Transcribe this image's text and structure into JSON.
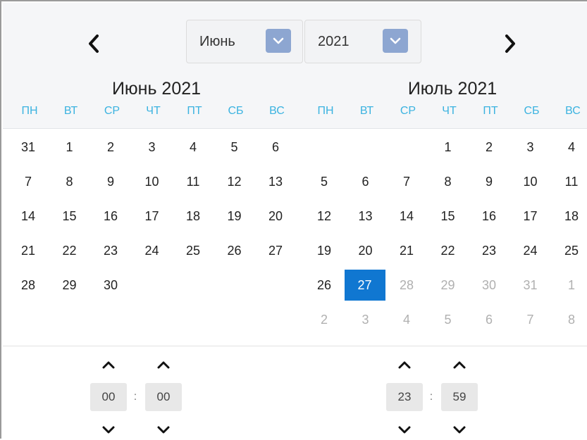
{
  "header": {
    "month_select": {
      "value": "Июнь"
    },
    "year_select": {
      "value": "2021"
    }
  },
  "calendars": [
    {
      "title": "Июнь 2021",
      "weekdays": [
        "ПН",
        "ВТ",
        "СР",
        "ЧТ",
        "ПТ",
        "СБ",
        "ВС"
      ],
      "weeks": [
        [
          {
            "d": "31",
            "m": false
          },
          {
            "d": "1",
            "m": false
          },
          {
            "d": "2",
            "m": false
          },
          {
            "d": "3",
            "m": false
          },
          {
            "d": "4",
            "m": false
          },
          {
            "d": "5",
            "m": false
          },
          {
            "d": "6",
            "m": false
          }
        ],
        [
          {
            "d": "7",
            "m": false
          },
          {
            "d": "8",
            "m": false
          },
          {
            "d": "9",
            "m": false
          },
          {
            "d": "10",
            "m": false
          },
          {
            "d": "11",
            "m": false
          },
          {
            "d": "12",
            "m": false
          },
          {
            "d": "13",
            "m": false
          }
        ],
        [
          {
            "d": "14",
            "m": false
          },
          {
            "d": "15",
            "m": false
          },
          {
            "d": "16",
            "m": false
          },
          {
            "d": "17",
            "m": false
          },
          {
            "d": "18",
            "m": false
          },
          {
            "d": "19",
            "m": false
          },
          {
            "d": "20",
            "m": false
          }
        ],
        [
          {
            "d": "21",
            "m": false
          },
          {
            "d": "22",
            "m": false
          },
          {
            "d": "23",
            "m": false
          },
          {
            "d": "24",
            "m": false
          },
          {
            "d": "25",
            "m": false
          },
          {
            "d": "26",
            "m": false
          },
          {
            "d": "27",
            "m": false
          }
        ],
        [
          {
            "d": "28",
            "m": false
          },
          {
            "d": "29",
            "m": false
          },
          {
            "d": "30",
            "m": false
          },
          null,
          null,
          null,
          null
        ],
        [
          null,
          null,
          null,
          null,
          null,
          null,
          null
        ]
      ]
    },
    {
      "title": "Июль 2021",
      "weekdays": [
        "ПН",
        "ВТ",
        "СР",
        "ЧТ",
        "ПТ",
        "СБ",
        "ВС"
      ],
      "weeks": [
        [
          null,
          null,
          null,
          {
            "d": "1",
            "m": false
          },
          {
            "d": "2",
            "m": false
          },
          {
            "d": "3",
            "m": false
          },
          {
            "d": "4",
            "m": false
          }
        ],
        [
          {
            "d": "5",
            "m": false
          },
          {
            "d": "6",
            "m": false
          },
          {
            "d": "7",
            "m": false
          },
          {
            "d": "8",
            "m": false
          },
          {
            "d": "9",
            "m": false
          },
          {
            "d": "10",
            "m": false
          },
          {
            "d": "11",
            "m": false
          }
        ],
        [
          {
            "d": "12",
            "m": false
          },
          {
            "d": "13",
            "m": false
          },
          {
            "d": "14",
            "m": false
          },
          {
            "d": "15",
            "m": false
          },
          {
            "d": "16",
            "m": false
          },
          {
            "d": "17",
            "m": false
          },
          {
            "d": "18",
            "m": false
          }
        ],
        [
          {
            "d": "19",
            "m": false
          },
          {
            "d": "20",
            "m": false
          },
          {
            "d": "21",
            "m": false
          },
          {
            "d": "22",
            "m": false
          },
          {
            "d": "23",
            "m": false
          },
          {
            "d": "24",
            "m": false
          },
          {
            "d": "25",
            "m": false
          }
        ],
        [
          {
            "d": "26",
            "m": false
          },
          {
            "d": "27",
            "m": false,
            "sel": true
          },
          {
            "d": "28",
            "m": true
          },
          {
            "d": "29",
            "m": true
          },
          {
            "d": "30",
            "m": true
          },
          {
            "d": "31",
            "m": true
          },
          {
            "d": "1",
            "m": true
          }
        ],
        [
          {
            "d": "2",
            "m": true
          },
          {
            "d": "3",
            "m": true
          },
          {
            "d": "4",
            "m": true
          },
          {
            "d": "5",
            "m": true
          },
          {
            "d": "6",
            "m": true
          },
          {
            "d": "7",
            "m": true
          },
          {
            "d": "8",
            "m": true
          }
        ]
      ]
    }
  ],
  "time_start": {
    "hours": "00",
    "separator": ":",
    "minutes": "00"
  },
  "time_end": {
    "hours": "23",
    "separator": ":",
    "minutes": "59"
  },
  "colors": {
    "accent": "#1077d1",
    "weekday_text": "#3bb3e0",
    "dropdown_arrow_bg": "#8da6d1",
    "muted_day": "#b0b0b0"
  },
  "icons": {
    "prev": "chevron-left-icon",
    "next": "chevron-right-icon",
    "dropdown": "chevron-down-icon",
    "increment": "chevron-up-icon",
    "decrement": "chevron-down-icon"
  }
}
